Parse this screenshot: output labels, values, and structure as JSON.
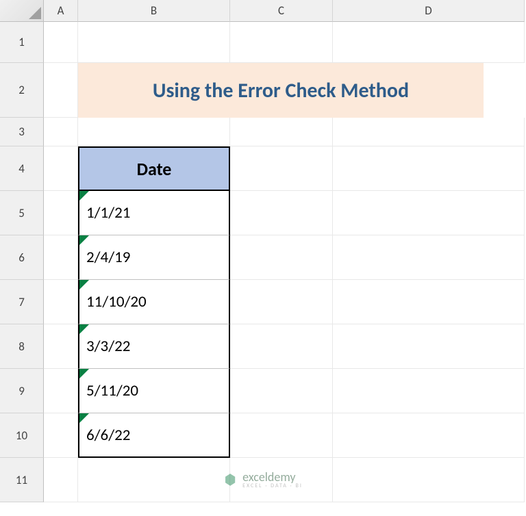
{
  "columns": [
    "A",
    "B",
    "C",
    "D"
  ],
  "rows": [
    "1",
    "2",
    "3",
    "4",
    "5",
    "6",
    "7",
    "8",
    "9",
    "10",
    "11"
  ],
  "title": "Using the Error Check Method",
  "table": {
    "header": "Date",
    "data": [
      "1/1/21",
      "2/4/19",
      "11/10/20",
      "3/3/22",
      "5/11/20",
      "6/6/22"
    ]
  },
  "watermark": {
    "main": "exceldemy",
    "sub": "EXCEL · DATA · BI"
  },
  "colors": {
    "title_bg": "#fce9da",
    "title_text": "#2e5c8a",
    "header_bg": "#b4c6e7",
    "error_green": "#0a8043"
  }
}
